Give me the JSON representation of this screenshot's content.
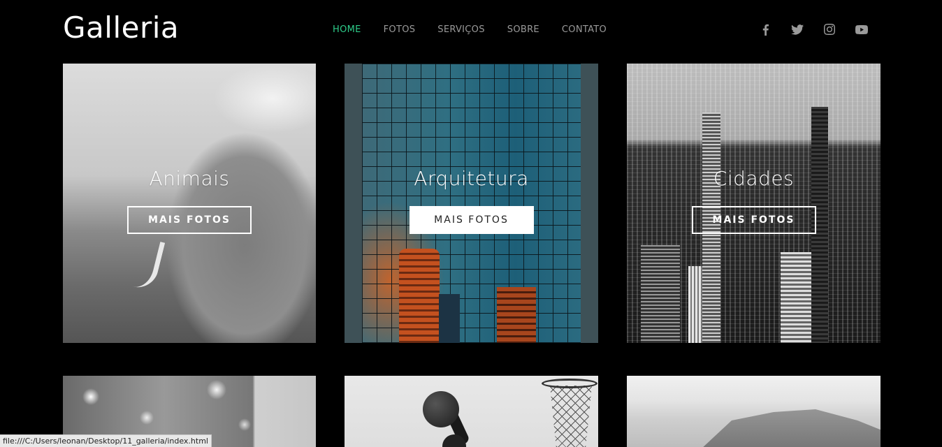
{
  "site": {
    "logo": "Galleria"
  },
  "nav": [
    {
      "label": "HOME",
      "active": true
    },
    {
      "label": "FOTOS",
      "active": false
    },
    {
      "label": "SERVIÇOS",
      "active": false
    },
    {
      "label": "SOBRE",
      "active": false
    },
    {
      "label": "CONTATO",
      "active": false
    }
  ],
  "social": [
    "facebook-icon",
    "twitter-icon",
    "instagram-icon",
    "youtube-icon"
  ],
  "colors": {
    "accent": "#2ecc8a",
    "nav_inactive": "#9a9a9a",
    "background": "#000000"
  },
  "cards": [
    {
      "title": "Animais",
      "button": "MAIS FOTOS"
    },
    {
      "title": "Arquitetura",
      "button": "MAIS FOTOS"
    },
    {
      "title": "Cidades",
      "button": "MAIS FOTOS"
    }
  ],
  "status_url": "file:///C:/Users/leonan/Desktop/11_galleria/index.html"
}
